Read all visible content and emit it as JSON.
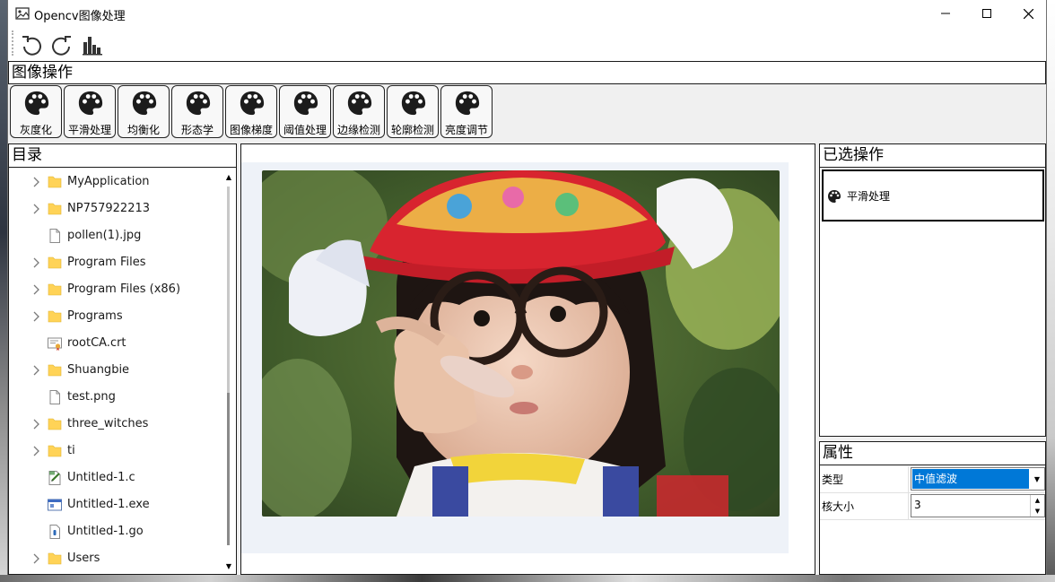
{
  "window": {
    "title": "Opencv图像处理"
  },
  "toolbar": {
    "buttons": [
      {
        "name": "undo-icon"
      },
      {
        "name": "redo-icon"
      },
      {
        "name": "histogram-icon"
      }
    ]
  },
  "operations": {
    "header": "图像操作",
    "items": [
      {
        "label": "灰度化",
        "icon": "palette-icon"
      },
      {
        "label": "平滑处理",
        "icon": "palette-icon"
      },
      {
        "label": "均衡化",
        "icon": "palette-icon"
      },
      {
        "label": "形态学",
        "icon": "palette-icon"
      },
      {
        "label": "图像梯度",
        "icon": "palette-icon"
      },
      {
        "label": "阈值处理",
        "icon": "palette-icon"
      },
      {
        "label": "边缘检测",
        "icon": "palette-icon"
      },
      {
        "label": "轮廓检测",
        "icon": "palette-icon"
      },
      {
        "label": "亮度调节",
        "icon": "palette-icon"
      }
    ]
  },
  "directory": {
    "header": "目录",
    "items": [
      {
        "name": "MyApplication",
        "type": "folder",
        "expandable": true
      },
      {
        "name": "NP757922213",
        "type": "folder",
        "expandable": true
      },
      {
        "name": "pollen(1).jpg",
        "type": "file",
        "expandable": false
      },
      {
        "name": "Program Files",
        "type": "folder",
        "expandable": true
      },
      {
        "name": "Program Files (x86)",
        "type": "folder",
        "expandable": true
      },
      {
        "name": "Programs",
        "type": "folder",
        "expandable": true
      },
      {
        "name": "rootCA.crt",
        "type": "certificate",
        "expandable": false
      },
      {
        "name": "Shuangbie",
        "type": "folder",
        "expandable": true
      },
      {
        "name": "test.png",
        "type": "file",
        "expandable": false
      },
      {
        "name": "three_witches",
        "type": "folder",
        "expandable": true
      },
      {
        "name": "ti",
        "type": "folder",
        "expandable": true
      },
      {
        "name": "Untitled-1.c",
        "type": "c-source",
        "expandable": false
      },
      {
        "name": "Untitled-1.exe",
        "type": "executable",
        "expandable": false
      },
      {
        "name": "Untitled-1.go",
        "type": "go-source",
        "expandable": false
      },
      {
        "name": "Users",
        "type": "folder",
        "expandable": true
      }
    ]
  },
  "selected_ops": {
    "header": "已选操作",
    "items": [
      {
        "label": "平滑处理",
        "icon": "palette-icon"
      }
    ]
  },
  "properties": {
    "header": "属性",
    "rows": [
      {
        "key": "类型",
        "value": "中值滤波",
        "control": "combo"
      },
      {
        "key": "核大小",
        "value": "3",
        "control": "spinner"
      }
    ]
  },
  "colors": {
    "accent": "#0078d7",
    "folder": "#ffd357",
    "canvas_bg": "#eef2f8"
  }
}
